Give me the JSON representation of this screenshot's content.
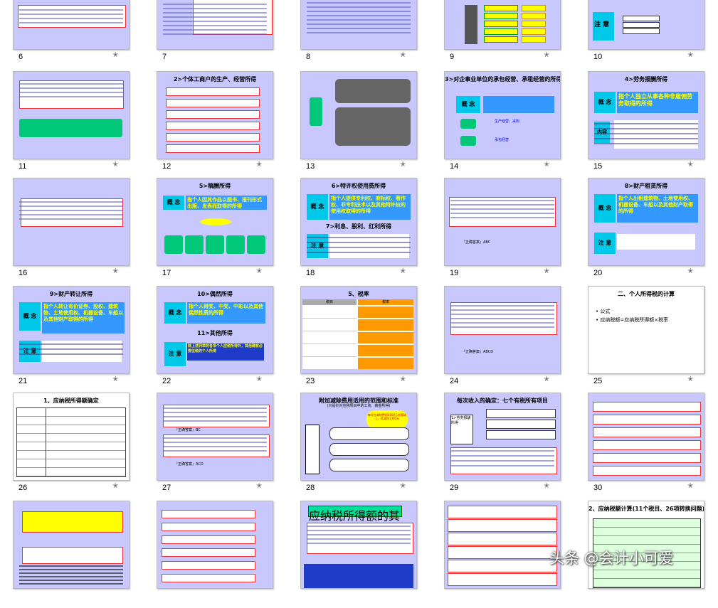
{
  "slides": [
    {
      "n": "6",
      "title": "",
      "star": true
    },
    {
      "n": "7",
      "title": "",
      "star": false
    },
    {
      "n": "8",
      "title": "",
      "star": true
    },
    {
      "n": "9",
      "title": "",
      "star": true
    },
    {
      "n": "10",
      "title": "",
      "star": true
    },
    {
      "n": "11",
      "title": "",
      "star": true
    },
    {
      "n": "12",
      "title": "2>个体工商户的生产、经营所得",
      "star": true
    },
    {
      "n": "13",
      "title": "",
      "star": true
    },
    {
      "n": "14",
      "title": "3>对企事业单位的承包经营、承租经营的所得",
      "star": true
    },
    {
      "n": "15",
      "title": "4>劳务报酬所得",
      "star": true
    },
    {
      "n": "16",
      "title": "",
      "star": true
    },
    {
      "n": "17",
      "title": "5>稿酬所得",
      "star": true
    },
    {
      "n": "18",
      "title": "6>特许权使用费所得",
      "star": true
    },
    {
      "n": "19",
      "title": "",
      "star": true
    },
    {
      "n": "20",
      "title": "8>财产租赁所得",
      "star": true
    },
    {
      "n": "21",
      "title": "9>财产转让所得",
      "star": true
    },
    {
      "n": "22",
      "title": "10>偶然所得",
      "star": true
    },
    {
      "n": "23",
      "title": "5、税率",
      "star": true
    },
    {
      "n": "24",
      "title": "",
      "star": true
    },
    {
      "n": "25",
      "title": "二、个人所得税的计算",
      "star": true
    },
    {
      "n": "26",
      "title": "1、应纳税所得额确定",
      "star": true
    },
    {
      "n": "27",
      "title": "",
      "star": true
    },
    {
      "n": "28",
      "title": "附加减除费用适用的范围和标准",
      "star": true
    },
    {
      "n": "29",
      "title": "每次收入的确定：七个有税所有项目",
      "star": true
    },
    {
      "n": "30",
      "title": "",
      "star": true
    },
    {
      "n": "",
      "title": "",
      "star": false
    },
    {
      "n": "",
      "title": "",
      "star": false
    },
    {
      "n": "",
      "title": "应纳税所得额的其他规定",
      "star": false
    },
    {
      "n": "",
      "title": "",
      "star": false
    },
    {
      "n": "",
      "title": "2、应纳税额计算(11个税目、26项转换问题)",
      "star": false
    }
  ],
  "labels": {
    "gainian": "概 念",
    "zhuyi": "注 意",
    "neirong": "内容",
    "s14_box1": "生产经营、采购",
    "s14_box2": "承包经营",
    "s15_main": "指个人独立从事各种非雇佣劳务取得的所得",
    "s17_main": "指个人因其作品以图书、报刊形式出版、发表而取得的所得",
    "s18_main": "指个人提供专利权、商标权、著作权、非专利技术以及其他特许权的使用权取得的所得",
    "s18_sub": "7>利息、股利、红利所得",
    "s20_main": "指个人出租建筑物、土地使用权、机器设备、车船以及其他财产取得的所得",
    "s21_main": "指个人转让有价证券、股权、建筑物、土地使用权、机器设备、车船以及其他财产取得的所得",
    "s22_main": "指个人得奖、中奖、中彩以及其他偶然性质的所得",
    "s22_sub": "11>其他所得",
    "s22_note": "除上述列举的各项个人应税所得外，其他确有必要征税的个人所得",
    "s25_bullet1": "• 公式",
    "s25_bullet2": "• 应纳税额=应纳税所得额×税率",
    "s19_ans": "『正确答案』ABC",
    "s24_ans": "『正确答案』ABCD",
    "s22_ans1": "『正确答案』BC",
    "s22_ans2": "『正确答案』ACD",
    "s28_sub": "(只是针对应税项目中的工资、薪金所得)",
    "s28_cloud": "每月在减除费用3500元的基础上，再减除1300元",
    "s29_left": "1>劳务报酬所得",
    "s23_col1": "税目",
    "s23_col2": "税率"
  },
  "watermark": "头条 @会计小可爱"
}
